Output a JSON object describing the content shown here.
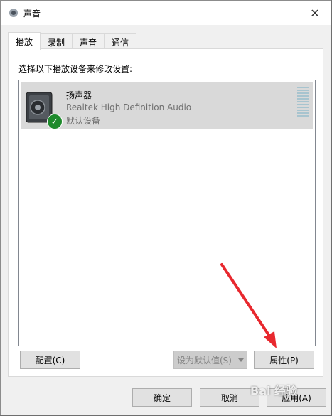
{
  "window": {
    "title": "声音",
    "close_glyph": "✕"
  },
  "tabs": [
    "播放",
    "录制",
    "声音",
    "通信"
  ],
  "instruction": "选择以下播放设备来修改设置:",
  "device": {
    "name": "扬声器",
    "driver": "Realtek High Definition Audio",
    "status": "默认设备",
    "icon": "speaker-icon",
    "check_glyph": "✓"
  },
  "buttons": {
    "configure": "配置(C)",
    "set_default": "设为默认值(S)",
    "properties": "属性(P)",
    "ok": "确定",
    "cancel": "取消",
    "apply": "应用(A)"
  },
  "watermark": "Bai 经验",
  "colors": {
    "selection": "#d9d9d9",
    "check": "#1e8a2c",
    "annotation_arrow": "#e8282e"
  }
}
